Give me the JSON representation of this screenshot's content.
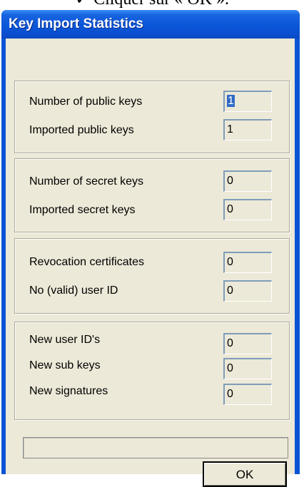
{
  "page_caption": "✓ Cliquer sur « OK ».",
  "window": {
    "title": "Key Import Statistics"
  },
  "groups": [
    {
      "rows": [
        {
          "label": "Number of public keys",
          "value": "1",
          "selected": true
        },
        {
          "label": "Imported public keys",
          "value": "1"
        }
      ]
    },
    {
      "rows": [
        {
          "label": "Number of secret keys",
          "value": "0"
        },
        {
          "label": "Imported secret keys",
          "value": "0"
        }
      ]
    },
    {
      "rows": [
        {
          "label": "Revocation certificates",
          "value": "0"
        },
        {
          "label": "No (valid) user ID",
          "value": "0"
        }
      ]
    },
    {
      "rows": [
        {
          "label": "New user ID's",
          "value": "0"
        },
        {
          "label": "New sub keys",
          "value": "0"
        },
        {
          "label": "New signatures",
          "value": "0"
        }
      ]
    }
  ],
  "buttons": {
    "ok_label": "OK"
  },
  "colors": {
    "titlebar": "#0a53d6",
    "dialog_bg": "#ece9d8",
    "selection": "#316ac5"
  }
}
